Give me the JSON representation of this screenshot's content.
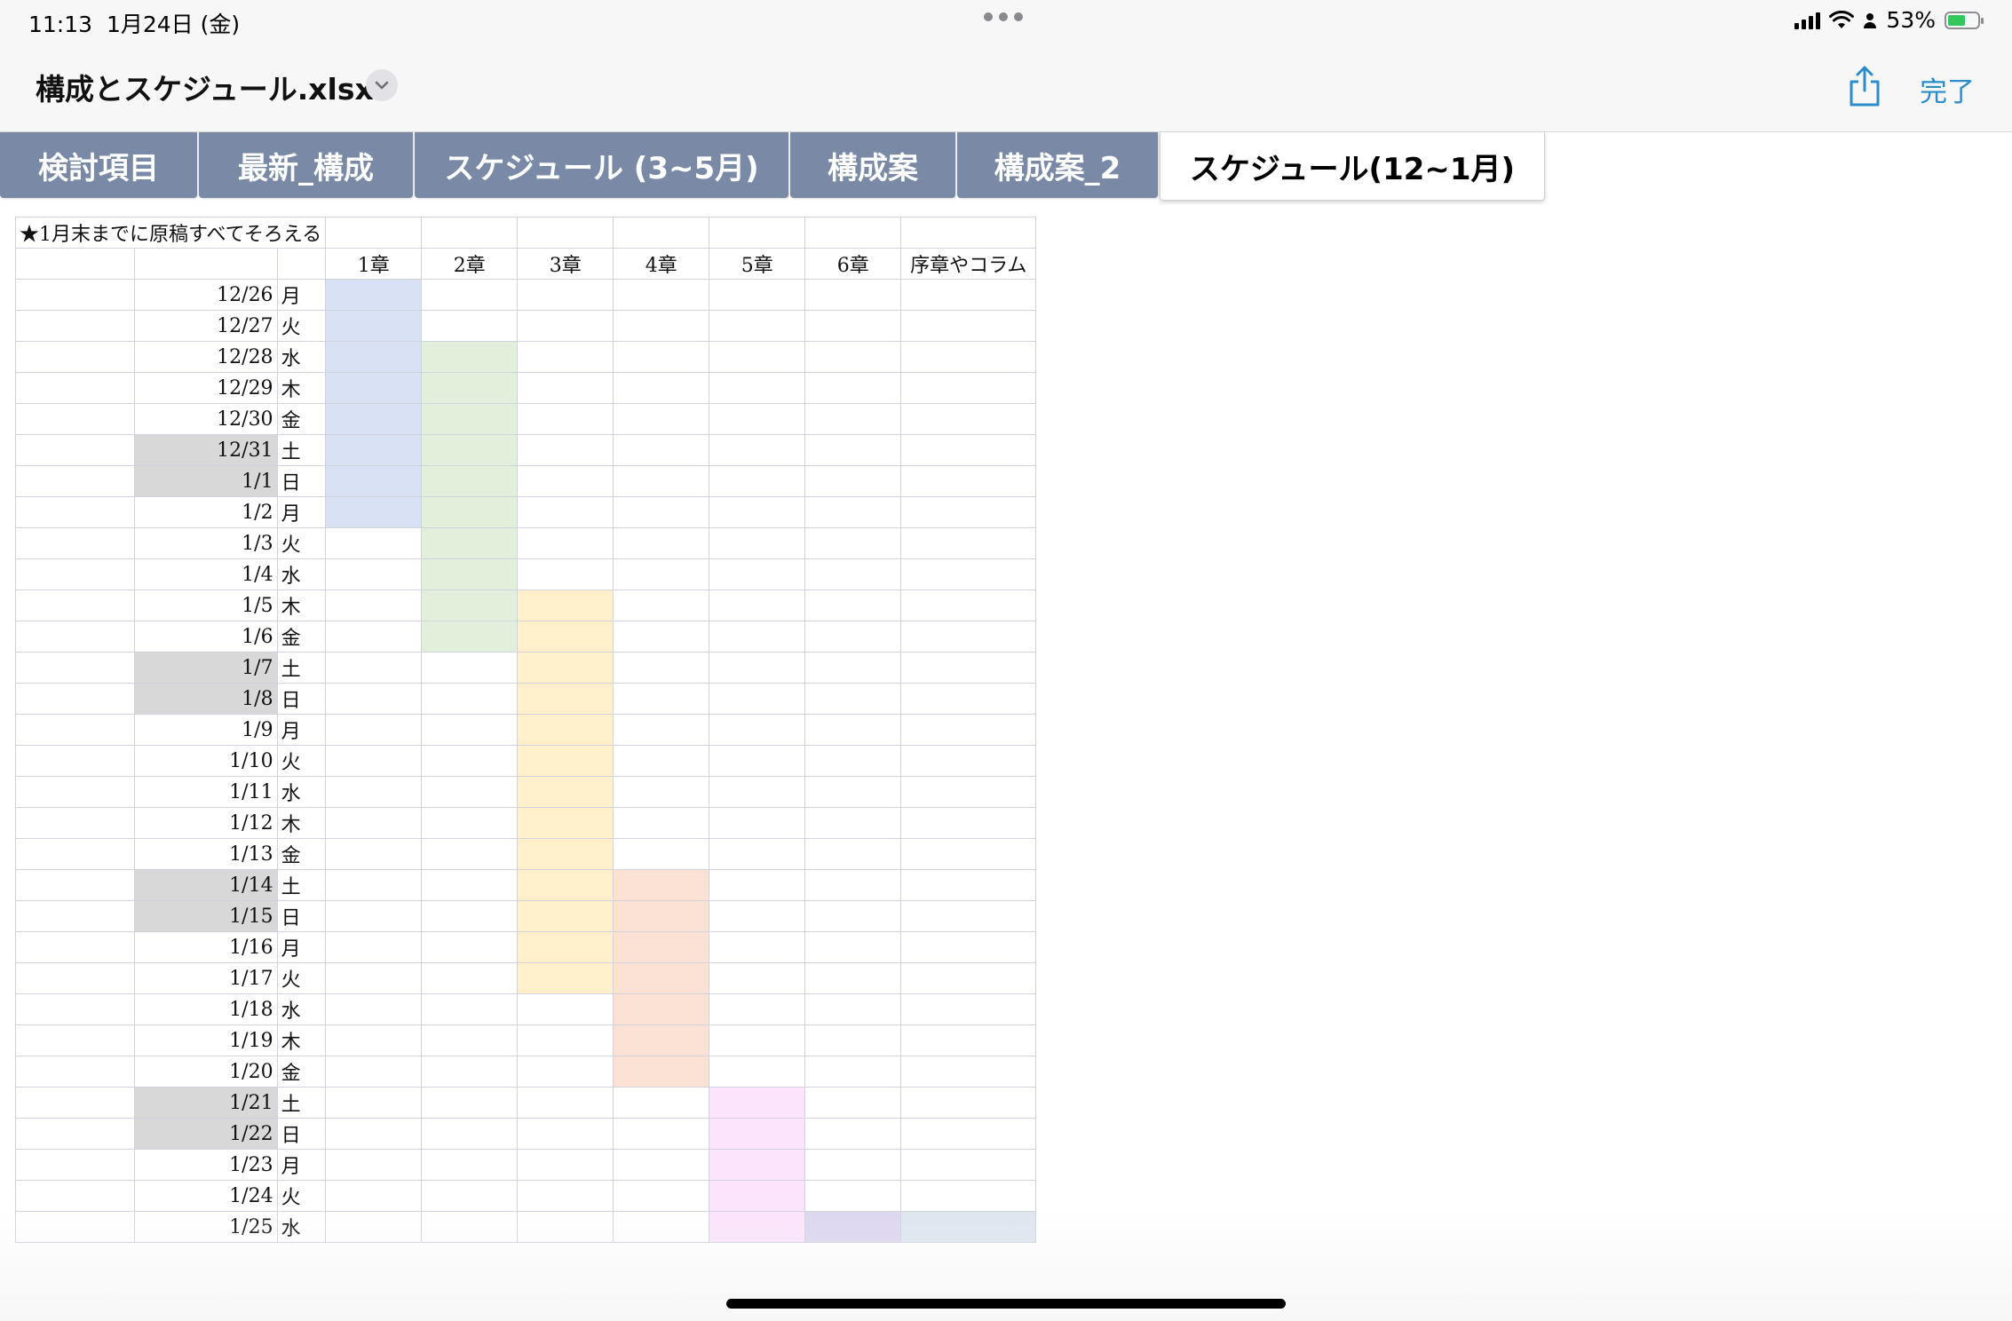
{
  "status": {
    "time": "11:13",
    "date": "1月24日 (金)",
    "battery": "53%",
    "battery_level": 0.53
  },
  "file": {
    "name": "構成とスケジュール.xlsx",
    "done_label": "完了"
  },
  "tabs": [
    {
      "label": "検討項目",
      "active": false
    },
    {
      "label": "最新_構成",
      "active": false
    },
    {
      "label": "スケジュール (3~5月)",
      "active": false
    },
    {
      "label": "構成案",
      "active": false
    },
    {
      "label": "構成案_2",
      "active": false
    },
    {
      "label": "スケジュール(12~1月)",
      "active": true
    }
  ],
  "sheet": {
    "note": "★1月末までに原稿すべてそろえる",
    "headers": [
      "1章",
      "2章",
      "3章",
      "4章",
      "5章",
      "6章",
      "序章やコラム"
    ],
    "chapter_colors": [
      "#d9e1f4",
      "#e2efda",
      "#fff0cc",
      "#fbe2d5",
      "#fce4fc",
      "#dcd6f0",
      "#dde6f0"
    ],
    "rows": [
      {
        "date": "12/26",
        "dow": "月",
        "weekend": false,
        "chapters": [
          0
        ]
      },
      {
        "date": "12/27",
        "dow": "火",
        "weekend": false,
        "chapters": [
          0
        ]
      },
      {
        "date": "12/28",
        "dow": "水",
        "weekend": false,
        "chapters": [
          0,
          1
        ]
      },
      {
        "date": "12/29",
        "dow": "木",
        "weekend": false,
        "chapters": [
          0,
          1
        ]
      },
      {
        "date": "12/30",
        "dow": "金",
        "weekend": false,
        "chapters": [
          0,
          1
        ]
      },
      {
        "date": "12/31",
        "dow": "土",
        "weekend": true,
        "chapters": [
          0,
          1
        ]
      },
      {
        "date": "1/1",
        "dow": "日",
        "weekend": true,
        "chapters": [
          0,
          1
        ]
      },
      {
        "date": "1/2",
        "dow": "月",
        "weekend": false,
        "chapters": [
          0,
          1
        ]
      },
      {
        "date": "1/3",
        "dow": "火",
        "weekend": false,
        "chapters": [
          1
        ]
      },
      {
        "date": "1/4",
        "dow": "水",
        "weekend": false,
        "chapters": [
          1
        ]
      },
      {
        "date": "1/5",
        "dow": "木",
        "weekend": false,
        "chapters": [
          1,
          2
        ]
      },
      {
        "date": "1/6",
        "dow": "金",
        "weekend": false,
        "chapters": [
          1,
          2
        ]
      },
      {
        "date": "1/7",
        "dow": "土",
        "weekend": true,
        "chapters": [
          2
        ]
      },
      {
        "date": "1/8",
        "dow": "日",
        "weekend": true,
        "chapters": [
          2
        ]
      },
      {
        "date": "1/9",
        "dow": "月",
        "weekend": false,
        "chapters": [
          2
        ]
      },
      {
        "date": "1/10",
        "dow": "火",
        "weekend": false,
        "chapters": [
          2
        ]
      },
      {
        "date": "1/11",
        "dow": "水",
        "weekend": false,
        "chapters": [
          2
        ]
      },
      {
        "date": "1/12",
        "dow": "木",
        "weekend": false,
        "chapters": [
          2
        ]
      },
      {
        "date": "1/13",
        "dow": "金",
        "weekend": false,
        "chapters": [
          2
        ]
      },
      {
        "date": "1/14",
        "dow": "土",
        "weekend": true,
        "chapters": [
          2,
          3
        ]
      },
      {
        "date": "1/15",
        "dow": "日",
        "weekend": true,
        "chapters": [
          2,
          3
        ]
      },
      {
        "date": "1/16",
        "dow": "月",
        "weekend": false,
        "chapters": [
          2,
          3
        ]
      },
      {
        "date": "1/17",
        "dow": "火",
        "weekend": false,
        "chapters": [
          2,
          3
        ]
      },
      {
        "date": "1/18",
        "dow": "水",
        "weekend": false,
        "chapters": [
          3
        ]
      },
      {
        "date": "1/19",
        "dow": "木",
        "weekend": false,
        "chapters": [
          3
        ]
      },
      {
        "date": "1/20",
        "dow": "金",
        "weekend": false,
        "chapters": [
          3
        ]
      },
      {
        "date": "1/21",
        "dow": "土",
        "weekend": true,
        "chapters": [
          4
        ]
      },
      {
        "date": "1/22",
        "dow": "日",
        "weekend": true,
        "chapters": [
          4
        ]
      },
      {
        "date": "1/23",
        "dow": "月",
        "weekend": false,
        "chapters": [
          4
        ]
      },
      {
        "date": "1/24",
        "dow": "火",
        "weekend": false,
        "chapters": [
          4
        ]
      },
      {
        "date": "1/25",
        "dow": "水",
        "weekend": false,
        "chapters": [
          4,
          5,
          6
        ]
      }
    ]
  }
}
